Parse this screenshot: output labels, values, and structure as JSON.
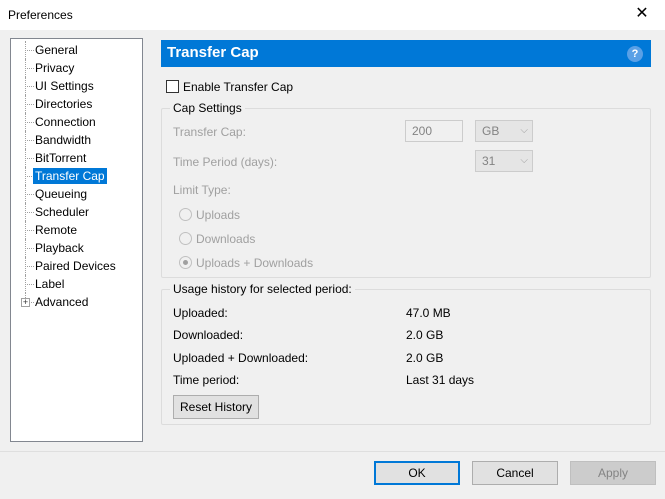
{
  "window": {
    "title": "Preferences",
    "close_glyph": "✕"
  },
  "tree": {
    "items": [
      {
        "label": "General"
      },
      {
        "label": "Privacy"
      },
      {
        "label": "UI Settings"
      },
      {
        "label": "Directories"
      },
      {
        "label": "Connection"
      },
      {
        "label": "Bandwidth"
      },
      {
        "label": "BitTorrent"
      },
      {
        "label": "Transfer Cap",
        "selected": true
      },
      {
        "label": "Queueing"
      },
      {
        "label": "Scheduler"
      },
      {
        "label": "Remote"
      },
      {
        "label": "Playback"
      },
      {
        "label": "Paired Devices"
      },
      {
        "label": "Label"
      },
      {
        "label": "Advanced",
        "expandable": true
      }
    ],
    "expander_glyph": "+"
  },
  "banner": {
    "title": "Transfer Cap",
    "help_glyph": "?",
    "color": "#0078d7"
  },
  "enable_cap": {
    "label": "Enable Transfer Cap",
    "checked": false
  },
  "cap_settings": {
    "title": "Cap Settings",
    "transfer_cap_label": "Transfer Cap:",
    "transfer_cap_value": "200",
    "transfer_cap_unit": "GB",
    "time_period_label": "Time Period (days):",
    "time_period_value": "31",
    "limit_type_label": "Limit Type:",
    "radios": [
      {
        "label": "Uploads",
        "checked": false
      },
      {
        "label": "Downloads",
        "checked": false
      },
      {
        "label": "Uploads + Downloads",
        "checked": true
      }
    ],
    "dropdown_glyph": "⌵"
  },
  "usage": {
    "title": "Usage history for selected period:",
    "rows": [
      {
        "label": "Uploaded:",
        "value": "47.0 MB"
      },
      {
        "label": "Downloaded:",
        "value": "2.0 GB"
      },
      {
        "label": "Uploaded + Downloaded:",
        "value": "2.0 GB"
      },
      {
        "label": "Time period:",
        "value": "Last 31 days"
      }
    ],
    "reset_label": "Reset History"
  },
  "footer": {
    "ok_label": "OK",
    "cancel_label": "Cancel",
    "apply_label": "Apply"
  }
}
